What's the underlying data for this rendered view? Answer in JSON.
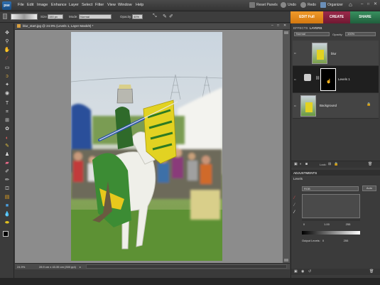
{
  "app": {
    "logo_text": "pse"
  },
  "menu": [
    "File",
    "Edit",
    "Image",
    "Enhance",
    "Layer",
    "Select",
    "Filter",
    "View",
    "Window",
    "Help"
  ],
  "top_buttons": {
    "reset_panels": "Reset Panels",
    "undo": "Undo",
    "redo": "Redo",
    "organizer": "Organizer"
  },
  "options": {
    "size_label": "Size:",
    "size_value": "150 px",
    "mode_label": "Mode:",
    "mode_value": "Normal",
    "opacity_label": "Opacity:",
    "opacity_value": "40%"
  },
  "modes": {
    "edit": "EDIT Full",
    "create": "CREATE",
    "share": "SHARE"
  },
  "document": {
    "tab_title": "blur_start.jpg @ 24.9% (Levels 1, Layer Mask/8) *",
    "zoom": "24.9%",
    "doc_info": "28.9 cm x 43.35 cm (300 ppi)"
  },
  "panels": {
    "tabs": [
      "EFFECTS",
      "LAYERS"
    ],
    "blend_mode": "Normal",
    "opacity_label": "Opacity:",
    "opacity_value": "100%",
    "layers": [
      {
        "name": "blur"
      },
      {
        "name": "Levels 1"
      },
      {
        "name": "Background"
      }
    ],
    "lock_label": "Lock:",
    "adjustments_title": "ADJUSTMENTS",
    "levels_title": "Levels",
    "channel": "RGB",
    "auto": "Auto",
    "input_levels": [
      "0",
      "1.00",
      "255"
    ],
    "output_label": "Output Levels:",
    "output_levels": [
      "0",
      "255"
    ]
  },
  "colors": {
    "edit_full": "#e38a1c",
    "create": "#8a1f3f",
    "share": "#2b7a4f",
    "accent": "#2f6fb0"
  },
  "tool_icons": [
    "move-icon",
    "zoom-icon",
    "hand-icon",
    "eyedropper-icon",
    "marquee-icon",
    "lasso-icon",
    "quick-selection-icon",
    "red-eye-icon",
    "spot-healing-icon",
    "smart-brush-icon",
    "text-icon",
    "crop-icon",
    "recompose-icon",
    "cookie-cutter-icon",
    "straighten-icon",
    "clone-stamp-icon",
    "eraser-icon",
    "brush-icon",
    "pencil-icon",
    "paint-bucket-icon",
    "gradient-icon",
    "shape-icon",
    "blur-icon",
    "sponge-icon",
    "color-swatch-icon"
  ]
}
